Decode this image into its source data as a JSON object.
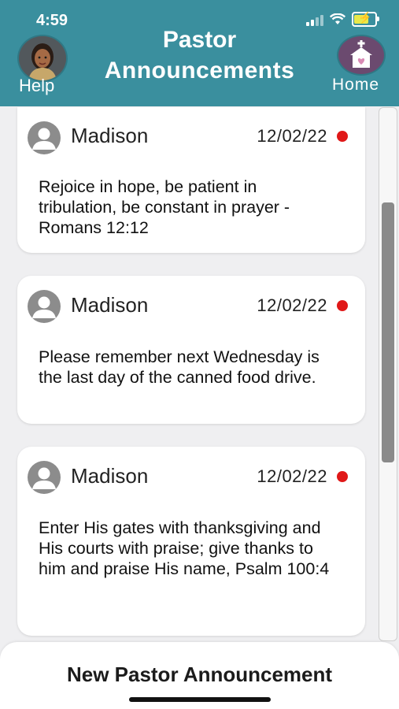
{
  "status_bar": {
    "time": "4:59"
  },
  "header": {
    "title_line1": "Pastor",
    "title_line2": "Announcements",
    "help_label": "Help",
    "home_label": "Home"
  },
  "announcements": [
    {
      "author": "Madison",
      "date": "12/02/22",
      "message": "Rejoice in hope, be patient in tribulation, be constant in prayer - Romans 12:12"
    },
    {
      "author": "Madison",
      "date": "12/02/22",
      "message": "Please remember next Wednesday is the last day of the canned food drive."
    },
    {
      "author": "Madison",
      "date": "12/02/22",
      "message": "Enter His gates with thanksgiving and His courts with praise; give thanks to him and praise His name, Psalm 100:4"
    }
  ],
  "footer": {
    "new_button_label": "New Pastor Announcement"
  },
  "colors": {
    "header_bg": "#3a8f9e",
    "unread_dot": "#e01818",
    "home_icon_bg": "#6b4a6f"
  },
  "icons": {
    "help": "avatar-icon",
    "home": "church-icon",
    "author": "user-icon",
    "unread": "dot-icon"
  }
}
